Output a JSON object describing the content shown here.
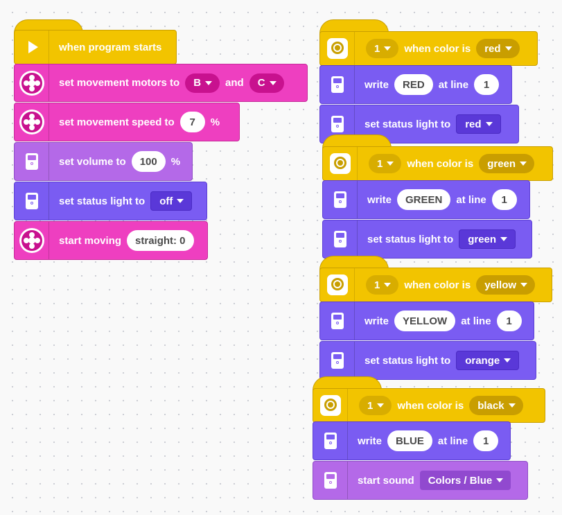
{
  "main_stack": {
    "start": {
      "label": "when program starts"
    },
    "motors": {
      "label": "set movement motors to",
      "port1": "B",
      "and": "and",
      "port2": "C"
    },
    "speed": {
      "label": "set movement speed to",
      "value": "7",
      "unit": "%"
    },
    "volume": {
      "label": "set volume to",
      "value": "100",
      "unit": "%"
    },
    "status": {
      "label": "set status light to",
      "value": "off"
    },
    "move": {
      "label": "start moving",
      "value": "straight: 0"
    }
  },
  "color_stacks": [
    {
      "port": "1",
      "when": "when color is",
      "color": "red",
      "write": "write",
      "text": "RED",
      "at_line": "at line",
      "line": "1",
      "action_label": "set status light to",
      "action_value": "red"
    },
    {
      "port": "1",
      "when": "when color is",
      "color": "green",
      "write": "write",
      "text": "GREEN",
      "at_line": "at line",
      "line": "1",
      "action_label": "set status light to",
      "action_value": "green"
    },
    {
      "port": "1",
      "when": "when color is",
      "color": "yellow",
      "write": "write",
      "text": "YELLOW",
      "at_line": "at line",
      "line": "1",
      "action_label": "set status light to",
      "action_value": "orange"
    },
    {
      "port": "1",
      "when": "when color is",
      "color": "black",
      "write": "write",
      "text": "BLUE",
      "at_line": "at line",
      "line": "1",
      "action_label": "start sound",
      "action_value": "Colors / Blue"
    }
  ],
  "colors": {
    "hat": "#f2c400",
    "pink": "#ee3fc0",
    "purple": "#7a5cf2",
    "lavender": "#b469e8"
  }
}
